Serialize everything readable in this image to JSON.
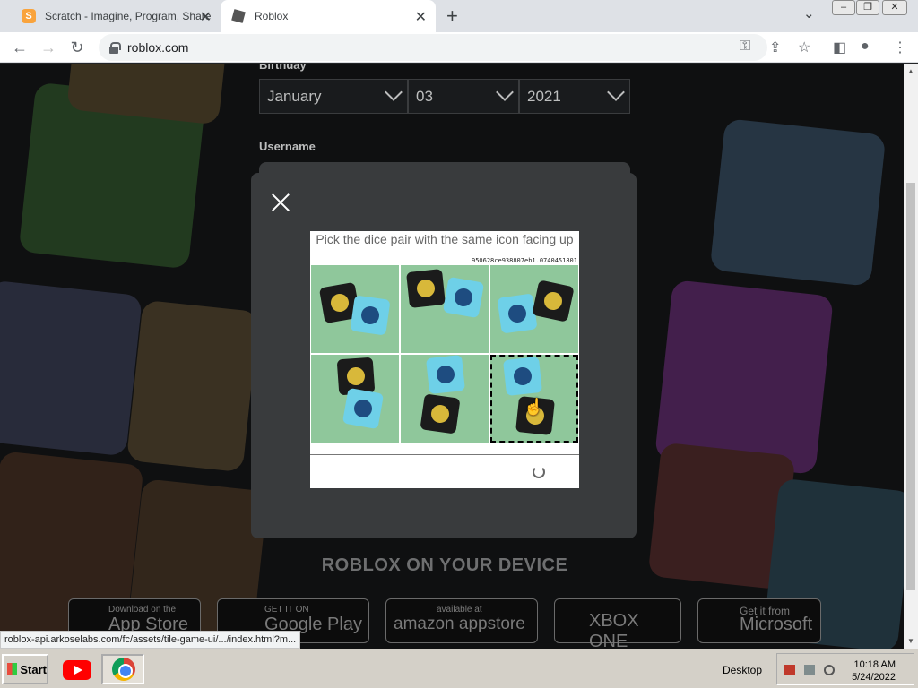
{
  "browser": {
    "tabs": [
      {
        "title": "Scratch - Imagine, Program, Share",
        "favicon": "scratch-icon",
        "active": false
      },
      {
        "title": "Roblox",
        "favicon": "roblox-icon",
        "active": true
      }
    ],
    "new_tab_label": "+",
    "url": "roblox.com",
    "status_url": "roblox-api.arkoselabs.com/fc/assets/tile-game-ui/.../index.html?m..."
  },
  "signup": {
    "birthday_label": "Birthday",
    "month": "January",
    "day": "03",
    "year": "2021",
    "username_label": "Username"
  },
  "captcha": {
    "prompt": "Pick the dice pair with the same icon facing up",
    "session_id": "950628ce938807eb1.0740451801",
    "selected_cell": 6,
    "cells": [
      1,
      2,
      3,
      4,
      5,
      6
    ]
  },
  "device_section": {
    "heading": "ROBLOX ON YOUR DEVICE",
    "stores": [
      {
        "small": "Download on the",
        "big": "App Store"
      },
      {
        "small": "GET IT ON",
        "big": "Google Play"
      },
      {
        "small": "available at",
        "big": "amazon appstore"
      },
      {
        "small": "",
        "big": "XBOX ONE"
      },
      {
        "small": "Get it from",
        "big": "Microsoft"
      }
    ]
  },
  "taskbar": {
    "start_label": "Start",
    "desktop_label": "Desktop",
    "time": "10:18 AM",
    "date": "5/24/2022"
  },
  "colors": {
    "modal_bg": "#393b3d",
    "page_bg": "#1d1e20",
    "captcha_tile": "#8fc79b",
    "die_dark": "#1b1b1b",
    "die_blue": "#6ed0e8"
  }
}
